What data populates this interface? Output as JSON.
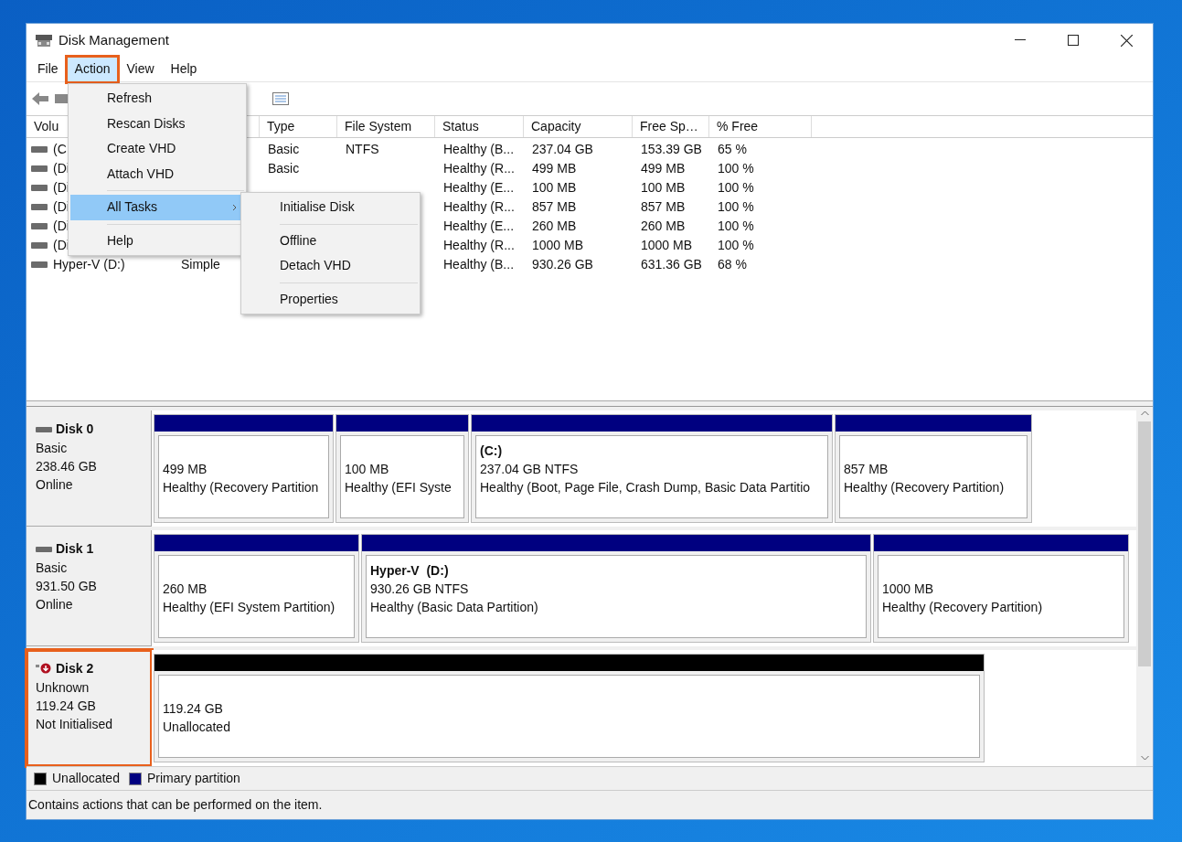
{
  "window": {
    "title": "Disk Management"
  },
  "menu_bar": [
    {
      "label": "File",
      "selected": false,
      "highlighted": false
    },
    {
      "label": "Action",
      "selected": true,
      "highlighted": true
    },
    {
      "label": "View",
      "selected": false,
      "highlighted": false
    },
    {
      "label": "Help",
      "selected": false,
      "highlighted": false
    }
  ],
  "action_menu": [
    {
      "kind": "item",
      "label": "Refresh",
      "selected": false
    },
    {
      "kind": "item",
      "label": "Rescan Disks",
      "selected": false
    },
    {
      "kind": "item",
      "label": "Create VHD",
      "selected": false
    },
    {
      "kind": "item",
      "label": "Attach VHD",
      "selected": false
    },
    {
      "kind": "separator"
    },
    {
      "kind": "submenu",
      "label": "All Tasks",
      "selected": true
    },
    {
      "kind": "separator"
    },
    {
      "kind": "item",
      "label": "Help",
      "selected": false
    }
  ],
  "all_tasks_submenu": [
    {
      "kind": "item",
      "label": "Initialise Disk",
      "selected": false
    },
    {
      "kind": "separator"
    },
    {
      "kind": "item",
      "label": "Offline",
      "selected": false
    },
    {
      "kind": "item",
      "label": "Detach VHD",
      "selected": false
    },
    {
      "kind": "separator"
    },
    {
      "kind": "item",
      "label": "Properties",
      "selected": false
    }
  ],
  "volume_table": {
    "columns": [
      "Volu",
      "",
      "",
      "Type",
      "File System",
      "Status",
      "Capacity",
      "Free Sp…",
      "% Free"
    ],
    "rows": [
      {
        "volume": "(C",
        "type": "Basic",
        "file_system": "NTFS",
        "status": "Healthy (B...",
        "capacity": "237.04 GB",
        "free_space": "153.39 GB",
        "percent_free": "65 %"
      },
      {
        "volume": "(Di",
        "type": "Basic",
        "status": "Healthy (R...",
        "capacity": "499 MB",
        "free_space": "499 MB",
        "percent_free": "100 %"
      },
      {
        "volume": "(Di",
        "status": "Healthy (E...",
        "capacity": "100 MB",
        "free_space": "100 MB",
        "percent_free": "100 %"
      },
      {
        "volume": "(Di",
        "status": "Healthy (R...",
        "capacity": "857 MB",
        "free_space": "857 MB",
        "percent_free": "100 %"
      },
      {
        "volume": "(Di",
        "status": "Healthy (E...",
        "capacity": "260 MB",
        "free_space": "260 MB",
        "percent_free": "100 %"
      },
      {
        "volume": "(Di",
        "status": "Healthy (R...",
        "capacity": "1000 MB",
        "free_space": "1000 MB",
        "percent_free": "100 %"
      },
      {
        "volume": "Hyper-V (D:)",
        "layout": "Simple",
        "status": "Healthy (B...",
        "capacity": "930.26 GB",
        "free_space": "631.36 GB",
        "percent_free": "68 %"
      }
    ]
  },
  "disks": [
    {
      "name": "Disk 0",
      "kind": "online",
      "highlighted": false,
      "lines": [
        "Basic",
        "238.46 GB",
        "Online"
      ],
      "partitions": [
        {
          "kind": "primary",
          "size": "499 MB",
          "status": "Healthy (Recovery Partition"
        },
        {
          "kind": "primary",
          "size": "100 MB",
          "status": "Healthy (EFI Syste"
        },
        {
          "kind": "primary",
          "label": "(C:)",
          "size": "237.04 GB NTFS",
          "status": "Healthy (Boot, Page File, Crash Dump, Basic Data Partitio"
        },
        {
          "kind": "primary",
          "size": "857 MB",
          "status": "Healthy (Recovery Partition)"
        }
      ]
    },
    {
      "name": "Disk 1",
      "kind": "online",
      "highlighted": false,
      "lines": [
        "Basic",
        "931.50 GB",
        "Online"
      ],
      "partitions": [
        {
          "kind": "primary",
          "size": "260 MB",
          "status": "Healthy (EFI System Partition)"
        },
        {
          "kind": "primary",
          "label": "Hyper-V  (D:)",
          "size": "930.26 GB NTFS",
          "status": "Healthy (Basic Data Partition)"
        },
        {
          "kind": "primary",
          "size": "1000 MB",
          "status": "Healthy (Recovery Partition)"
        }
      ]
    },
    {
      "name": "Disk 2",
      "kind": "not_initialised",
      "highlighted": true,
      "lines": [
        "Unknown",
        "119.24 GB",
        "Not Initialised"
      ],
      "partitions": [
        {
          "kind": "unallocated",
          "size": "119.24 GB",
          "status": "Unallocated"
        }
      ]
    }
  ],
  "legend": [
    {
      "label": "Unallocated",
      "color": "#000000"
    },
    {
      "label": "Primary partition",
      "color": "#000080"
    }
  ],
  "status_bar": "Contains actions that can be performed on the item."
}
